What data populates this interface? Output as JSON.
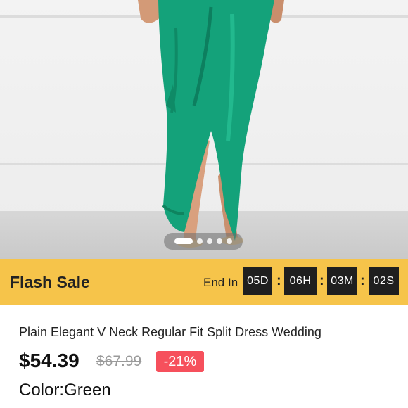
{
  "product_image": {
    "alt": "green-satin-split-dress-photo",
    "carousel": {
      "slide_count": 5,
      "active_index": 0
    }
  },
  "flash_sale": {
    "title": "Flash Sale",
    "end_label": "End In",
    "countdown": [
      "05D",
      "06H",
      "03M",
      "02S"
    ]
  },
  "product": {
    "title": "Plain Elegant V Neck Regular Fit  Split  Dress Wedding",
    "price": "$54.39",
    "original_price": "$67.99",
    "discount": "-21%",
    "color_label": "Color:Green"
  },
  "colors": {
    "dress_green": "#14a27a",
    "flash_bar": "#f6c44a",
    "discount_badge": "#f6505c",
    "countdown_bg": "#1f1f1f"
  }
}
